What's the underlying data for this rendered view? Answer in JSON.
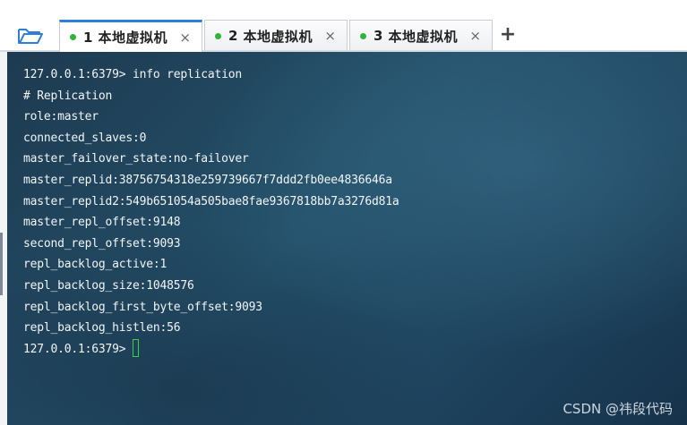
{
  "tabs": [
    {
      "number": "1",
      "title": "本地虚拟机",
      "close": "×",
      "active": true
    },
    {
      "number": "2",
      "title": "本地虚拟机",
      "close": "×",
      "active": false
    },
    {
      "number": "3",
      "title": "本地虚拟机",
      "close": "×",
      "active": false
    }
  ],
  "add_tab_label": "+",
  "terminal": {
    "lines": [
      "127.0.0.1:6379> info replication",
      "# Replication",
      "role:master",
      "connected_slaves:0",
      "master_failover_state:no-failover",
      "master_replid:38756754318e259739667f7ddd2fb0ee4836646a",
      "master_replid2:549b651054a505bae8fae9367818bb7a3276d81a",
      "master_repl_offset:9148",
      "second_repl_offset:9093",
      "repl_backlog_active:1",
      "repl_backlog_size:1048576",
      "repl_backlog_first_byte_offset:9093",
      "repl_backlog_histlen:56"
    ],
    "prompt": "127.0.0.1:6379>"
  },
  "watermark": "CSDN @祎段代码",
  "colors": {
    "accent": "#2f7fd8",
    "status_dot": "#2fb43a",
    "cursor": "#3ad24a",
    "folder_icon": "#2f7fd8"
  },
  "icons": {
    "open_folder": "folder-open-icon",
    "tab_status": "green-dot-icon",
    "tab_close": "close-icon",
    "new_tab": "plus-icon"
  }
}
